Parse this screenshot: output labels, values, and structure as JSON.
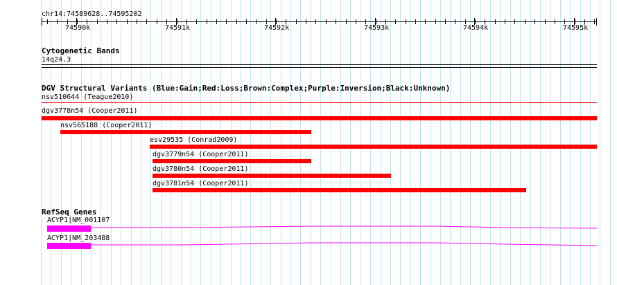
{
  "ruler": {
    "range": "chr14:74589628..74595202",
    "ticks": [
      {
        "label": "74590k",
        "bp": 74590000
      },
      {
        "label": "74591k",
        "bp": 74591000
      },
      {
        "label": "74592k",
        "bp": 74592000
      },
      {
        "label": "74593k",
        "bp": 74593000
      },
      {
        "label": "74594k",
        "bp": 74594000
      },
      {
        "label": "74595k",
        "bp": 74595000
      }
    ]
  },
  "cytobands": {
    "title": "Cytogenetic Bands",
    "band": "14q24.3"
  },
  "dgv": {
    "title": "DGV Structural Variants (Blue:Gain;Red:Loss;Brown:Complex;Purple:Inversion;Black:Unknown)",
    "loss_color": "#ff0000",
    "variants": [
      {
        "label": "nsv510644 (Teague2010)"
      },
      {
        "label": "dgv3778n54 (Cooper2011)"
      },
      {
        "label": "nsv565188 (Cooper2011)"
      },
      {
        "label": "esv29535 (Conrad2009)"
      },
      {
        "label": "dgv3779n54 (Cooper2011)"
      },
      {
        "label": "dgv3780n54 (Cooper2011)"
      },
      {
        "label": "dgv3781n54 (Cooper2011)"
      }
    ]
  },
  "refseq": {
    "title": "RefSeq Genes",
    "color": "#ff00ff",
    "genes": [
      {
        "label": "ACYP1|NM_001107"
      },
      {
        "label": "ACYP1|NM_203488"
      }
    ]
  },
  "grid_color": "#bfe6f0"
}
